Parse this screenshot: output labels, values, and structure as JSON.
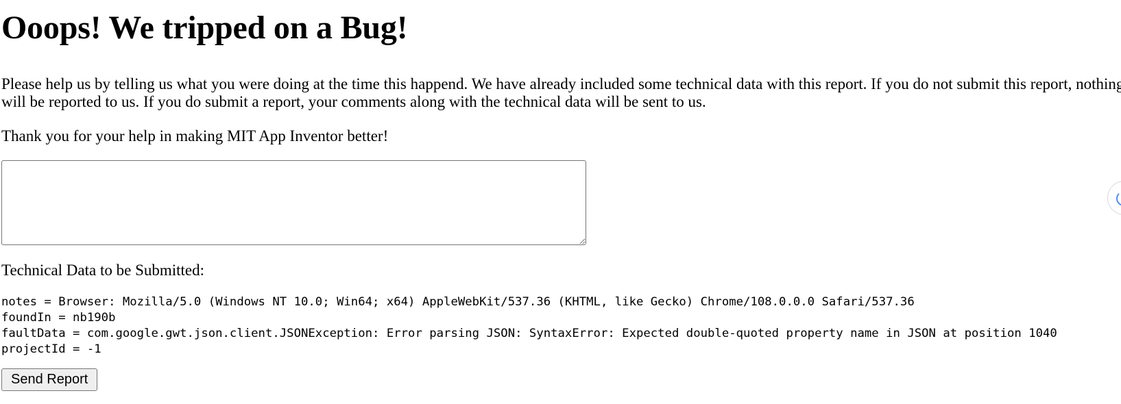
{
  "heading": "Ooops! We tripped on a Bug!",
  "intro": "Please help us by telling us what you were doing at the time this happend. We have already included some technical data with this report. If you do not submit this report, nothing will be reported to us. If you do submit a report, your comments along with the technical data will be sent to us.",
  "thanks": "Thank you for your help in making MIT App Inventor better!",
  "comments": {
    "value": "",
    "placeholder": ""
  },
  "tech_title": "Technical Data to be Submitted:",
  "tech_lines": [
    "notes = Browser: Mozilla/5.0 (Windows NT 10.0; Win64; x64) AppleWebKit/537.36 (KHTML, like Gecko) Chrome/108.0.0.0 Safari/537.36",
    "foundIn = nb190b",
    "faultData = com.google.gwt.json.client.JSONException: Error parsing JSON: SyntaxError: Expected double-quoted property name in JSON at position 1040",
    "projectId = -1"
  ],
  "send_button": "Send Report",
  "side_widget_icon": "loading-spinner-icon",
  "colors": {
    "spinner": "#4a8ef0",
    "button_bg": "#efefef",
    "border": "#767676"
  }
}
